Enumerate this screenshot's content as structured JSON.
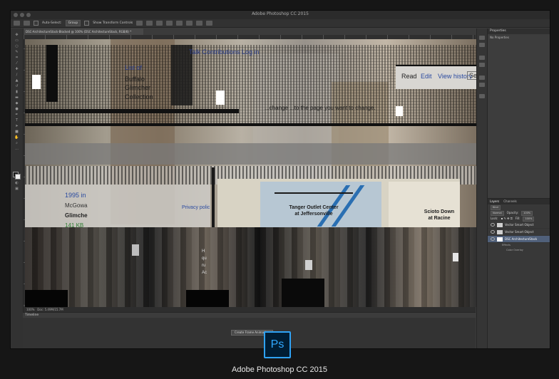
{
  "window": {
    "title": "Adobe Photoshop CC 2015",
    "traffic_lights": [
      "close",
      "minimize",
      "zoom"
    ]
  },
  "options_bar": {
    "auto_select_label": "Auto-Select:",
    "auto_select_value": "Group",
    "transform_label": "Show Transform Controls"
  },
  "document": {
    "tab_title": "DSC-ArchitectureStack-Blocked @ 100% (DSC ArchitectureStack, RGB/8) *",
    "zoom": "100%",
    "doc_size": "Doc: 5.49M/15.7M"
  },
  "canvas_text": {
    "talk_line": "Talk   Contributions   Log in",
    "read_tab": "Read",
    "edit_tab": "Edit",
    "history_tab": "View history",
    "search_hint": "Se",
    "change_line": "...change ...to the page you want to change.",
    "left_list": [
      "List of",
      "Buffalo",
      "Glimcher",
      "Collection"
    ],
    "year_text": "1995 in",
    "mcgowan": "McGowa",
    "glimcher": "Glimche",
    "size": "141 KB",
    "privacy": "Privacy polic",
    "map_label_1": "Tanger Outlet Center\nat Jeffersonville",
    "map_label_2": "Scioto Down\nat Racine",
    "sidebar_snippets": [
      "H",
      "qu",
      "ru",
      "Ac"
    ]
  },
  "timeline": {
    "label": "Timeline",
    "create_button": "Create Frame Animation"
  },
  "properties_panel": {
    "title": "Properties",
    "empty_text": "No Properties"
  },
  "layers_panel": {
    "tabs": [
      "Layers",
      "Channels"
    ],
    "kind": "Kind",
    "blend_mode": "Normal",
    "opacity_label": "Opacity:",
    "opacity": "100%",
    "lock_label": "Lock:",
    "fill_label": "Fill:",
    "fill": "100%",
    "layers": [
      "Vector Smart Object",
      "Vector Smart Object",
      "DSC ArchitectureStack"
    ],
    "effects": [
      "Effects",
      "Color Overlay"
    ]
  },
  "branding": {
    "logo_text": "Ps",
    "caption": "Adobe Photoshop CC 2015",
    "accent": "#31a8ff"
  }
}
